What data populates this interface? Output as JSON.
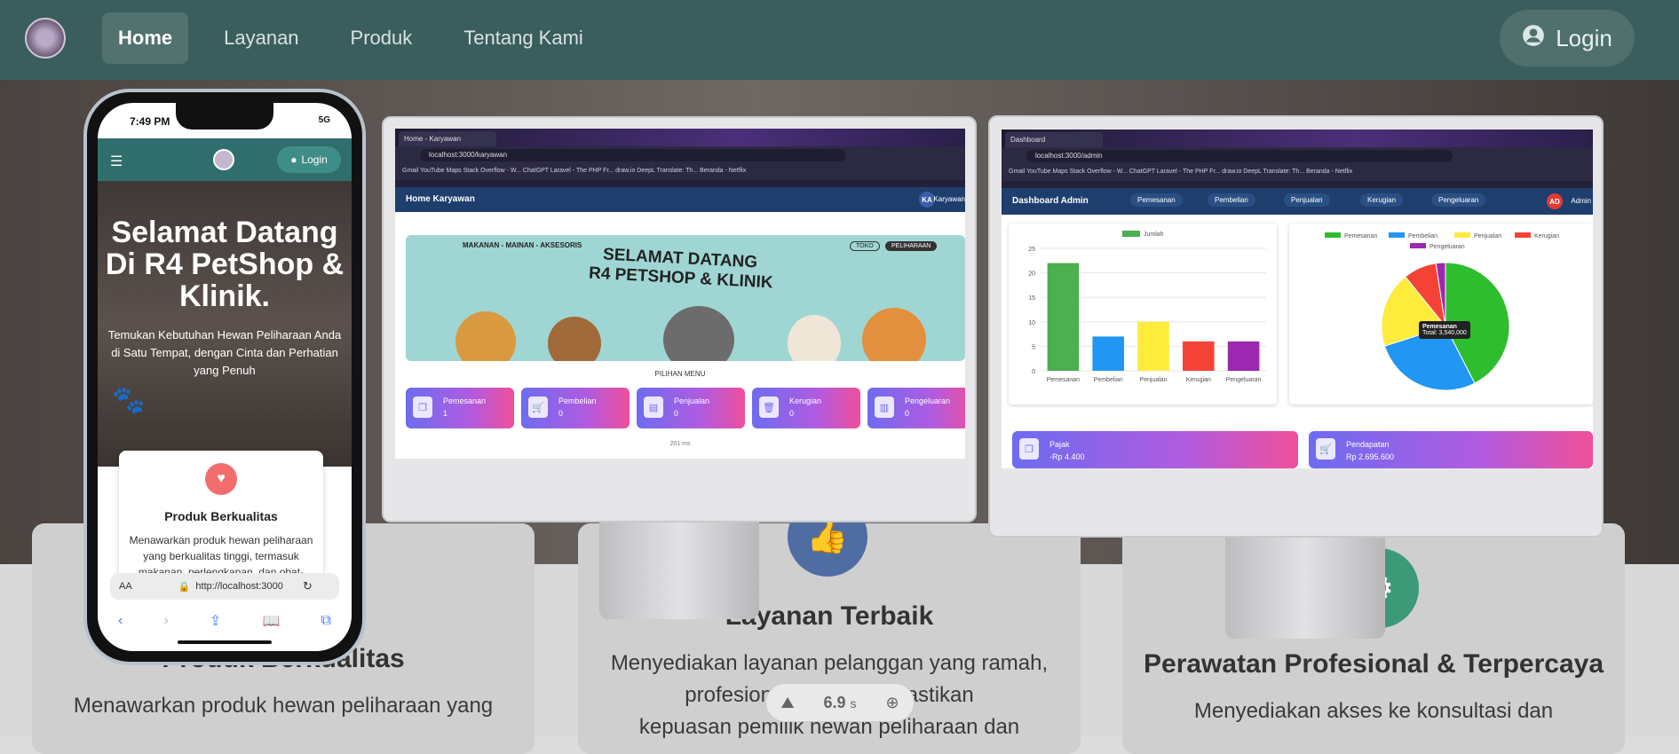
{
  "header": {
    "nav": [
      "Home",
      "Layanan",
      "Produk",
      "Tentang Kami"
    ],
    "login": "Login"
  },
  "features": [
    {
      "title": "Produk Berkualitas",
      "desc": "Menawarkan produk hewan peliharaan yang"
    },
    {
      "title": "Layanan Terbaik",
      "desc1": "Menyediakan layanan pelanggan yang ramah,",
      "desc2": "profesional, dan       k memastikan",
      "desc3": "kepuasan pemilik hewan peliharaan dan"
    },
    {
      "title": "Perawatan Profesional & Terpercaya",
      "desc": "Menyediakan akses ke konsultasi dan"
    }
  ],
  "phone": {
    "time": "7:49 PM",
    "signal": "5G",
    "login": "Login",
    "hero_title": "Selamat Datang Di R4 PetShop & Klinik.",
    "hero_sub": "Temukan Kebutuhan Hewan Peliharaan Anda di Satu Tempat, dengan Cinta dan Perhatian yang Penuh",
    "card_title": "Produk Berkualitas",
    "card_desc": "Menawarkan produk hewan peliharaan yang berkualitas tinggi, termasuk makanan, perlengkapan, dan obat-",
    "url": "http://localhost:3000",
    "aa": "AA"
  },
  "monitor1": {
    "tab": "Home - Karyawan",
    "url": "localhost:3000/karyawan",
    "bookmarks": "Gmail   YouTube   Maps   Stack Overflow - W...   ChatGPT   Laravel - The PHP Fr...   draw.io   DeepL Translate: Th...   Beranda - Netflix",
    "appbar": "Home Karyawan",
    "badge": "KA",
    "user": "Karyawan",
    "banner_top": "MAKANAN - MAINAN - AKSESORIS",
    "banner_title1": "SELAMAT DATANG",
    "banner_title2": "R4 PETSHOP & KLINIK",
    "toko": "TOKO",
    "peliharaan": "PELIHARAAN",
    "menu_label": "PILIHAN MENU",
    "cards": [
      {
        "label": "Pemesanan",
        "value": "1"
      },
      {
        "label": "Pembelian",
        "value": "0"
      },
      {
        "label": "Penjualan",
        "value": "0"
      },
      {
        "label": "Kerugian",
        "value": "0"
      },
      {
        "label": "Pengeluaran",
        "value": "0"
      }
    ],
    "footer": "201 ms"
  },
  "monitor2": {
    "tab": "Dashboard",
    "url": "localhost:3000/admin",
    "bookmarks": "Gmail   YouTube   Maps   Stack Overflow - W...   ChatGPT   Laravel - The PHP Fr...   draw.io   DeepL Translate: Th...   Beranda - Netflix",
    "appbar": "Dashboard Admin",
    "menu": [
      "Pemesanan",
      "Pembelian",
      "Penjualan",
      "Kerugian",
      "Pengeluaran"
    ],
    "badge": "AD",
    "user": "Admin",
    "tooltip_title": "Pemesanan",
    "tooltip_value": "Total: 3,540,000",
    "pajak_label": "Pajak",
    "pajak_value": "-Rp 4.400",
    "pendapatan_label": "Pendapatan",
    "pendapatan_value": "Rp 2.695.600"
  },
  "chart_data": [
    {
      "type": "bar",
      "categories": [
        "Pemesanan",
        "Pembelian",
        "Penjualan",
        "Kerugian",
        "Pengeluaran"
      ],
      "series": [
        {
          "name": "Jumlah",
          "values": [
            22,
            7,
            10,
            6,
            6
          ]
        }
      ],
      "ylim": [
        0,
        25
      ],
      "yticks": [
        0,
        5,
        10,
        15,
        20,
        25
      ],
      "colors": [
        "#4caf50",
        "#2196f3",
        "#ffeb3b",
        "#f44336",
        "#9c27b0"
      ]
    },
    {
      "type": "pie",
      "labels": [
        "Pemesanan",
        "Pembelian",
        "Penjualan",
        "Kerugian",
        "Pengeluaran"
      ],
      "values": [
        3540000,
        2300000,
        1600000,
        700000,
        200000
      ],
      "colors": [
        "#2ebd2e",
        "#2196f3",
        "#ffeb3b",
        "#f44336",
        "#9c27b0"
      ]
    }
  ],
  "timer": {
    "value": "6.9",
    "unit": "s"
  }
}
